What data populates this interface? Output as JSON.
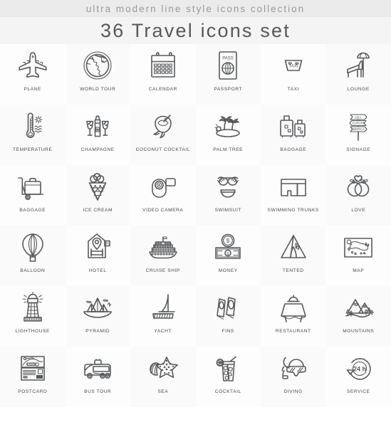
{
  "header": {
    "subtitle": "ultra modern line style icons collection",
    "title": "36 Travel icons set",
    "count": 36,
    "theme": "Travel",
    "colors": {
      "stroke": "#58595b",
      "label": "#4a4a4a",
      "title": "#585858",
      "subtitle": "#9a9a9a",
      "band_top": "#ebebeb",
      "band_bottom": "#f4f4f4",
      "cell_bg": "#fdfdfd",
      "cell_bg_tint": "#fafafa"
    }
  },
  "grid": {
    "columns": 6,
    "rows": 6,
    "total": 36
  },
  "icons": [
    {
      "label": "PLANE",
      "icon": "plane-icon"
    },
    {
      "label": "WORLD TOUR",
      "icon": "globe-icon"
    },
    {
      "label": "CALENDAR",
      "icon": "calendar-icon"
    },
    {
      "label": "PASSPORT",
      "icon": "passport-icon",
      "inner_text": "PASS"
    },
    {
      "label": "TAXI",
      "icon": "taxi-icon",
      "inner_text": "TAXI"
    },
    {
      "label": "LOUNGE",
      "icon": "lounge-chair-icon"
    },
    {
      "label": "TEMPERATURE",
      "icon": "thermometer-icon"
    },
    {
      "label": "CHAMPAGNE",
      "icon": "champagne-icon"
    },
    {
      "label": "COCONUT COCKTAIL",
      "icon": "coconut-cocktail-icon"
    },
    {
      "label": "PALM TREE",
      "icon": "palm-tree-icon"
    },
    {
      "label": "BAGGAGE",
      "icon": "suitcases-icon"
    },
    {
      "label": "SIGNAGE",
      "icon": "signpost-icon",
      "signs": [
        "ASIA",
        "EUROPE",
        "AMERICA"
      ]
    },
    {
      "label": "BAGGAGE",
      "icon": "luggage-cart-icon"
    },
    {
      "label": "ICE CREAM",
      "icon": "ice-cream-icon"
    },
    {
      "label": "VIDEO CAMERA",
      "icon": "video-camera-icon"
    },
    {
      "label": "SWIMSUIT",
      "icon": "bikini-icon"
    },
    {
      "label": "SWIMMING TRUNKS",
      "icon": "swim-trunks-icon"
    },
    {
      "label": "LOVE",
      "icon": "wedding-rings-icon"
    },
    {
      "label": "BALLOON",
      "icon": "hot-air-balloon-icon"
    },
    {
      "label": "HOTEL",
      "icon": "hotel-icon",
      "inner_text": "H"
    },
    {
      "label": "CRUISE SHIP",
      "icon": "cruise-ship-icon"
    },
    {
      "label": "MONEY",
      "icon": "money-icon",
      "inner_text": "$"
    },
    {
      "label": "TENTED",
      "icon": "tent-icon"
    },
    {
      "label": "MAP",
      "icon": "map-icon"
    },
    {
      "label": "LIGHTHOUSE",
      "icon": "lighthouse-icon"
    },
    {
      "label": "PYRAMID",
      "icon": "pyramid-icon"
    },
    {
      "label": "YACHT",
      "icon": "yacht-icon"
    },
    {
      "label": "FINS",
      "icon": "swim-fins-icon"
    },
    {
      "label": "RESTAURANT",
      "icon": "restaurant-table-icon"
    },
    {
      "label": "MOUNTAINS",
      "icon": "mountains-icon"
    },
    {
      "label": "POSTCARD",
      "icon": "postcard-icon",
      "inner_text": "SUMMER"
    },
    {
      "label": "BUS TOUR",
      "icon": "bus-icon"
    },
    {
      "label": "SEA",
      "icon": "starfish-shell-icon"
    },
    {
      "label": "COCKTAIL",
      "icon": "cocktail-glass-icon"
    },
    {
      "label": "DIVING",
      "icon": "diving-mask-icon"
    },
    {
      "label": "SERVICE",
      "icon": "24h-service-icon",
      "inner_text": "24 h"
    }
  ]
}
